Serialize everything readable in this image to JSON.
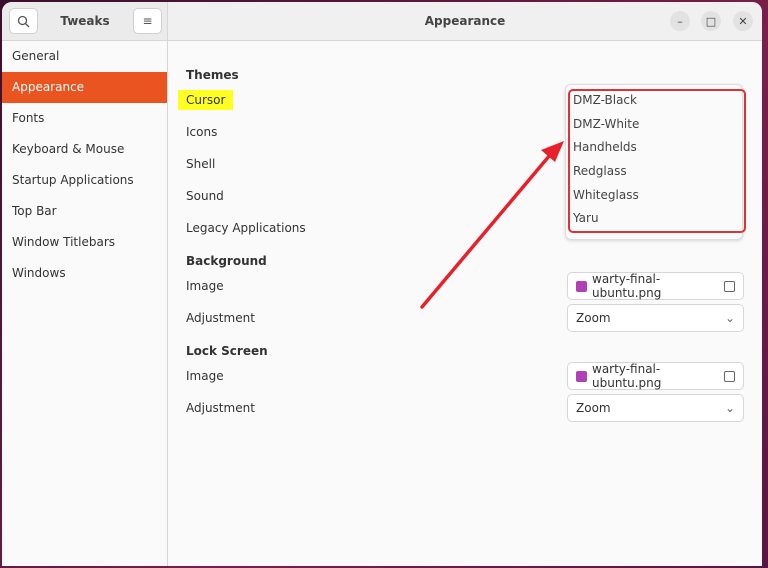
{
  "header": {
    "sidebar_title": "Tweaks",
    "title": "Appearance"
  },
  "sidebar": {
    "items": [
      {
        "label": "General"
      },
      {
        "label": "Appearance",
        "active": true
      },
      {
        "label": "Fonts"
      },
      {
        "label": "Keyboard & Mouse"
      },
      {
        "label": "Startup Applications"
      },
      {
        "label": "Top Bar"
      },
      {
        "label": "Window Titlebars"
      },
      {
        "label": "Windows"
      }
    ]
  },
  "themes": {
    "heading": "Themes",
    "cursor": "Cursor",
    "icons": "Icons",
    "shell": "Shell",
    "sound": "Sound",
    "legacy": "Legacy Applications"
  },
  "cursor_options": [
    "DMZ-Black",
    "DMZ-White",
    "Handhelds",
    "Redglass",
    "Whiteglass",
    "Yaru"
  ],
  "background": {
    "heading": "Background",
    "image_label": "Image",
    "image_value": "warty-final-ubuntu.png",
    "adjustment_label": "Adjustment",
    "adjustment_value": "Zoom"
  },
  "lock_screen": {
    "heading": "Lock Screen",
    "image_label": "Image",
    "image_value": "warty-final-ubuntu.png",
    "adjustment_label": "Adjustment",
    "adjustment_value": "Zoom"
  },
  "colors": {
    "accent": "#e95420",
    "highlight": "#ffff22",
    "annotation": "#e0303a"
  }
}
